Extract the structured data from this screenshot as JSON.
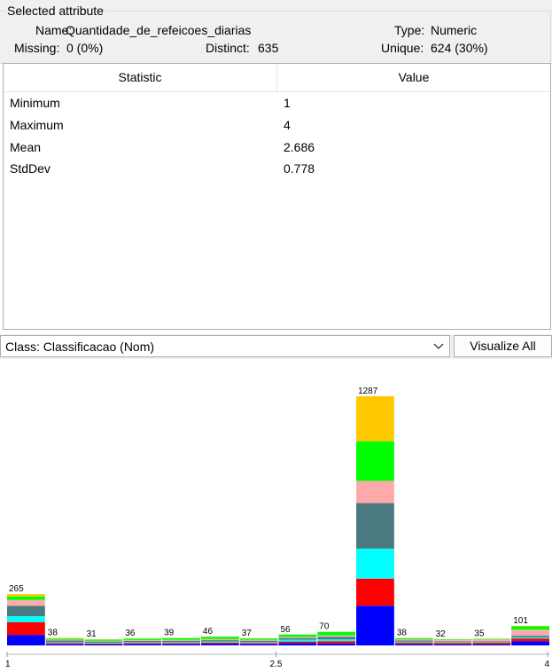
{
  "selected_attribute": {
    "group_title": "Selected attribute",
    "name_label": "Name:",
    "name_value": "Quantidade_de_refeicoes_diarias",
    "type_label": "Type:",
    "type_value": "Numeric",
    "missing_label": "Missing:",
    "missing_value": "0 (0%)",
    "distinct_label": "Distinct:",
    "distinct_value": "635",
    "unique_label": "Unique:",
    "unique_value": "624 (30%)"
  },
  "stats_table": {
    "headers": [
      "Statistic",
      "Value"
    ],
    "rows": [
      {
        "stat": "Minimum",
        "value": "1"
      },
      {
        "stat": "Maximum",
        "value": "4"
      },
      {
        "stat": "Mean",
        "value": "2.686"
      },
      {
        "stat": "StdDev",
        "value": "0.778"
      }
    ]
  },
  "class_selector": {
    "selected": "Class: Classificacao (Nom)",
    "icon": "chevron-down-icon"
  },
  "visualize_all_label": "Visualize All",
  "chart_data": {
    "type": "bar",
    "stacked": true,
    "x_tick_labels": [
      "1",
      "2.5",
      "4"
    ],
    "xlim": [
      1,
      4
    ],
    "bin_totals": [
      265,
      38,
      31,
      36,
      39,
      46,
      37,
      56,
      70,
      1287,
      38,
      32,
      35,
      101
    ],
    "class_colors": [
      "#0000ff",
      "#ff0000",
      "#00ffff",
      "#4a7a80",
      "#ffaaaa",
      "#00ff00",
      "#ffc800"
    ],
    "bins_stacks": [
      [
        45,
        55,
        25,
        45,
        25,
        15,
        10
      ],
      [
        6,
        6,
        5,
        8,
        5,
        6,
        2
      ],
      [
        5,
        5,
        4,
        6,
        4,
        6,
        1
      ],
      [
        6,
        6,
        5,
        6,
        5,
        7,
        1
      ],
      [
        6,
        6,
        5,
        7,
        5,
        9,
        1
      ],
      [
        7,
        7,
        6,
        7,
        6,
        12,
        1
      ],
      [
        6,
        6,
        5,
        7,
        5,
        7,
        1
      ],
      [
        12,
        8,
        10,
        8,
        6,
        12,
        0
      ],
      [
        10,
        12,
        10,
        12,
        8,
        18,
        0
      ],
      [
        205,
        140,
        155,
        235,
        115,
        205,
        232
      ],
      [
        6,
        8,
        5,
        6,
        6,
        6,
        1
      ],
      [
        5,
        8,
        4,
        4,
        6,
        4,
        1
      ],
      [
        5,
        9,
        4,
        4,
        9,
        3,
        1
      ],
      [
        22,
        14,
        6,
        8,
        31,
        18,
        2
      ]
    ]
  }
}
